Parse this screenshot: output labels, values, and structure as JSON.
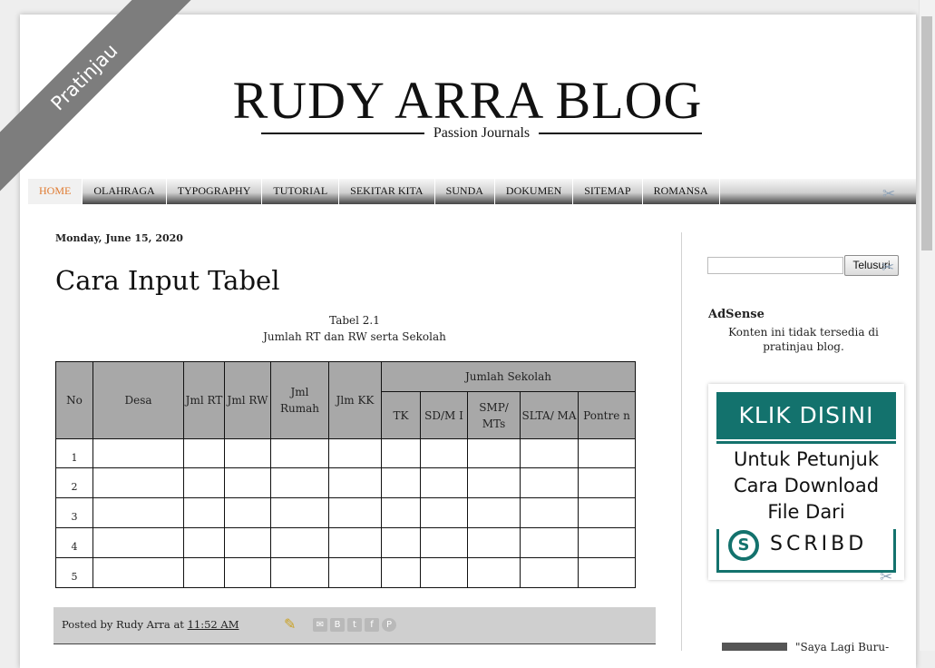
{
  "ribbon": "Pratinjau",
  "header": {
    "title": "RUDY ARRA BLOG",
    "tagline": "Passion Journals"
  },
  "nav": {
    "items": [
      "HOME",
      "OLAHRAGA",
      "TYPOGRAPHY",
      "TUTORIAL",
      "SEKITAR KITA",
      "SUNDA",
      "DOKUMEN",
      "SITEMAP",
      "ROMANSA"
    ],
    "active": "HOME",
    "active_color": "#e07a30"
  },
  "post": {
    "date": "Monday, June 15, 2020",
    "title": "Cara Input Tabel",
    "caption_line1": "Tabel 2.1",
    "caption_line2": "Jumlah RT dan RW serta Sekolah",
    "table": {
      "headers": {
        "no": "No",
        "desa": "Desa",
        "jml_rt": "Jml RT",
        "jml_rw": "Jml RW",
        "jml_rumah": "Jml Rumah",
        "jlm_kk": "Jlm KK",
        "jumlah_sekolah": "Jumlah Sekolah"
      },
      "sub_headers": [
        "TK",
        "SD/M I",
        "SMP/ MTs",
        "SLTA/ MA",
        "Pontre n"
      ],
      "rows": [
        "1",
        "2",
        "3",
        "4",
        "5"
      ],
      "header_bg": "#a8a8a8"
    },
    "footer": {
      "posted_by": "Posted by Rudy Arra at ",
      "time": "11:52 AM"
    }
  },
  "sidebar": {
    "search_button": "Telusuri",
    "adsense_heading": "AdSense",
    "adsense_text": "Konten ini tidak tersedia di pratinjau blog.",
    "banner": {
      "klik": "KLIK DISINI",
      "line1": "Untuk Petunjuk",
      "line2": "Cara Download",
      "line3": "File Dari",
      "brand": "SCRIBD",
      "color": "#13726d"
    },
    "next_post": "\"Saya Lagi Buru-"
  }
}
